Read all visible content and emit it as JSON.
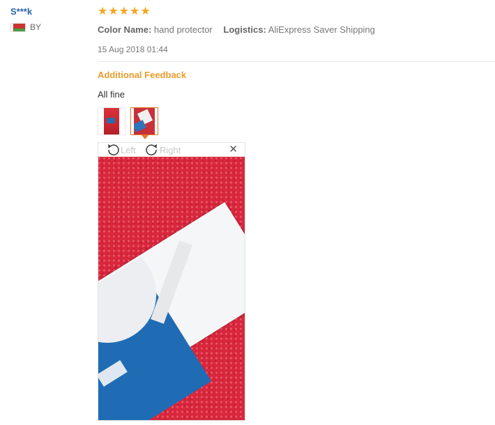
{
  "user": {
    "name": "S***k",
    "country": "BY",
    "flag_icon": "belarus-flag-icon"
  },
  "review": {
    "rating": 5,
    "stars_max": 5,
    "attributes": [
      {
        "label": "Color Name:",
        "value": "hand protector"
      },
      {
        "label": "Logistics:",
        "value": "AliExpress Saver Shipping"
      }
    ],
    "date": "15 Aug 2018 01:44",
    "additional_title": "Additional Feedback",
    "feedback_text": "All fine"
  },
  "viewer": {
    "rotate_left_label": "Left",
    "rotate_right_label": "Right",
    "close_icon": "close-icon"
  },
  "colors": {
    "username": "#2a63ad",
    "star": "#f5a623",
    "additional_title": "#e89c2c",
    "selected_thumb": "#e0792b"
  }
}
